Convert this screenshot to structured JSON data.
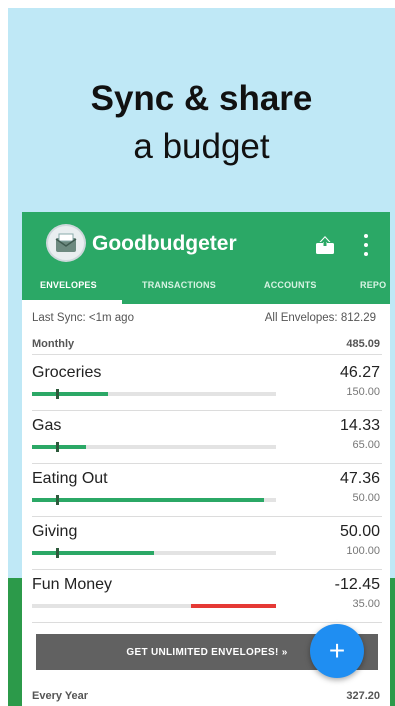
{
  "promo": {
    "headline_line1": "Sync & share",
    "headline_line2": "a budget"
  },
  "colors": {
    "app_green": "#2ba866",
    "promo_blue": "#bfe8f6",
    "negative_red": "#e53935",
    "fab_blue": "#1f8ef2"
  },
  "app": {
    "title": "Goodbudgeter",
    "share_icon": "share-upload-icon",
    "more_icon": "more-vert-icon"
  },
  "tabs": [
    {
      "label": "ENVELOPES",
      "active": true
    },
    {
      "label": "TRANSACTIONS",
      "active": false
    },
    {
      "label": "ACCOUNTS",
      "active": false
    },
    {
      "label": "REPO",
      "active": false
    }
  ],
  "sync": {
    "last_sync": "Last Sync: <1m ago",
    "all_envelopes": "All Envelopes: 812.29"
  },
  "groups": {
    "monthly_label": "Monthly",
    "monthly_total": "485.09",
    "yearly_label": "Every Year",
    "yearly_total": "327.20"
  },
  "envelopes": [
    {
      "name": "Groceries",
      "amount": "46.27",
      "budget": "150.00",
      "fill": 0.31,
      "marker": 0.1,
      "negative": false
    },
    {
      "name": "Gas",
      "amount": "14.33",
      "budget": "65.00",
      "fill": 0.22,
      "marker": 0.1,
      "negative": false
    },
    {
      "name": "Eating Out",
      "amount": "47.36",
      "budget": "50.00",
      "fill": 0.95,
      "marker": 0.1,
      "negative": false
    },
    {
      "name": "Giving",
      "amount": "50.00",
      "budget": "100.00",
      "fill": 0.5,
      "marker": 0.1,
      "negative": false
    },
    {
      "name": "Fun Money",
      "amount": "-12.45",
      "budget": "35.00",
      "fill": 0.35,
      "marker": 0.1,
      "negative": true
    }
  ],
  "upsell": {
    "label": "GET UNLIMITED ENVELOPES! »"
  },
  "fab": {
    "label": "+",
    "icon": "add-icon"
  }
}
